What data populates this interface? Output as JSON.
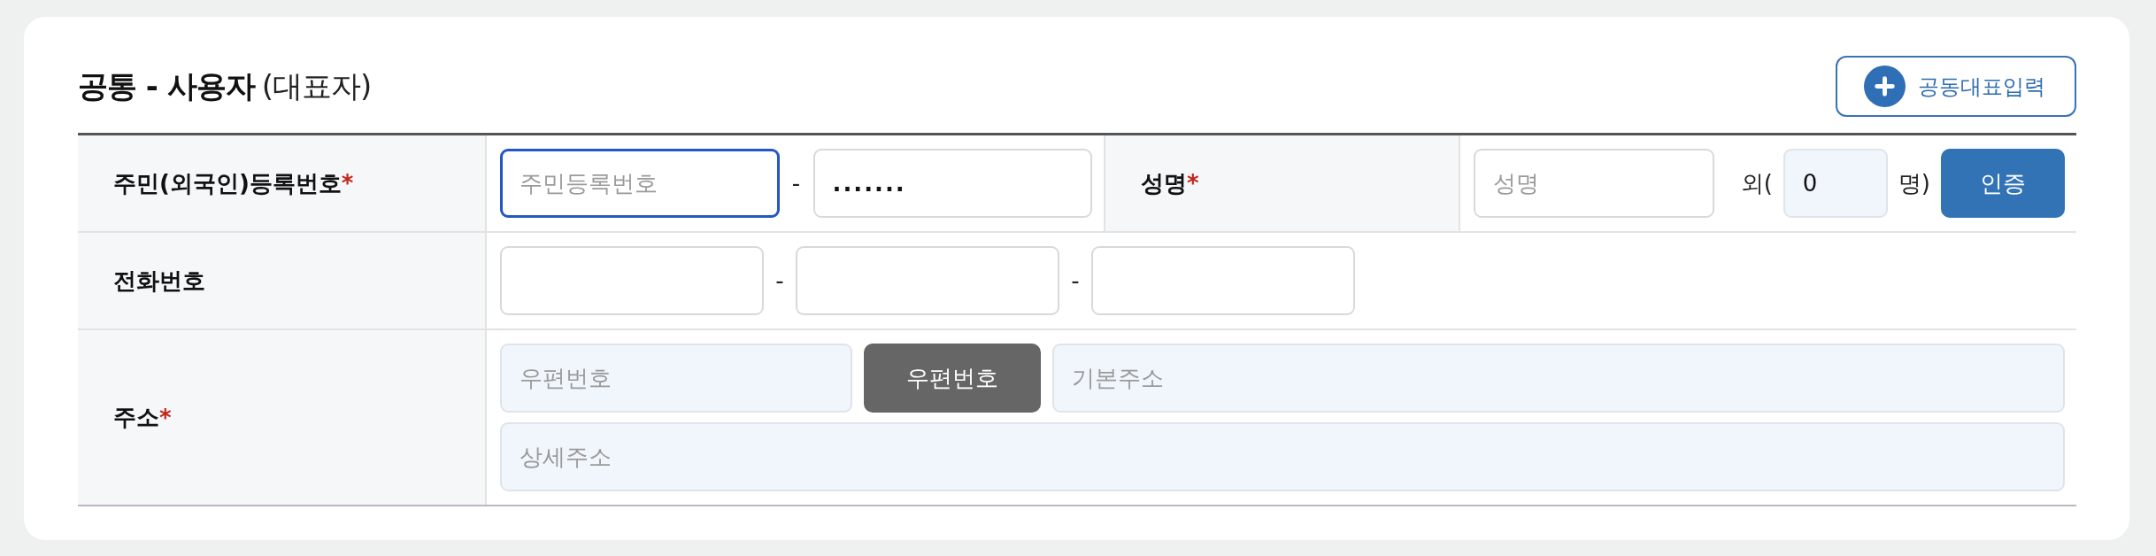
{
  "header": {
    "title": "공통 - 사용자",
    "subtitle": "(대표자)",
    "add_button": "공동대표입력"
  },
  "rows": [
    {
      "cells": [
        {
          "kind": "label",
          "text": "주민(외국인)등록번호",
          "required_mark": "*"
        },
        {
          "kind": "idnumber",
          "items": [
            {
              "kind": "input",
              "placeholder": "주민등록번호",
              "focused": true,
              "readonly": false,
              "masked": false
            },
            {
              "kind": "separator",
              "text": "-"
            },
            {
              "kind": "input",
              "value": ".......",
              "focused": false,
              "readonly": false,
              "masked": true
            }
          ]
        },
        {
          "kind": "label",
          "text": "성명",
          "required_mark": "*"
        },
        {
          "kind": "name",
          "items": [
            {
              "kind": "input",
              "placeholder": "성명",
              "focused": false,
              "readonly": false
            },
            {
              "kind": "text",
              "text": "외("
            },
            {
              "kind": "input",
              "value": "0",
              "focused": false,
              "readonly": true
            },
            {
              "kind": "text",
              "text": "명)"
            },
            {
              "kind": "button",
              "label": "인증"
            }
          ]
        }
      ]
    },
    {
      "cells": [
        {
          "kind": "label",
          "text": "전화번호"
        },
        {
          "kind": "phone",
          "items": [
            {
              "kind": "input",
              "focused": false,
              "readonly": false
            },
            {
              "kind": "separator",
              "text": "-"
            },
            {
              "kind": "input",
              "focused": false,
              "readonly": false
            },
            {
              "kind": "separator",
              "text": "-"
            },
            {
              "kind": "input",
              "focused": false,
              "readonly": false
            }
          ]
        }
      ]
    },
    {
      "cells": [
        {
          "kind": "label",
          "text": "주소",
          "required_mark": "*"
        },
        {
          "kind": "address",
          "items": [
            {
              "kind": "input",
              "placeholder": "우편번호",
              "focused": false,
              "readonly": true
            },
            {
              "kind": "button",
              "label": "우편번호"
            },
            {
              "kind": "input",
              "placeholder": "기본주소",
              "focused": false,
              "readonly": true
            },
            {
              "kind": "input",
              "placeholder": "상세주소",
              "focused": false,
              "readonly": true
            }
          ]
        }
      ]
    }
  ]
}
